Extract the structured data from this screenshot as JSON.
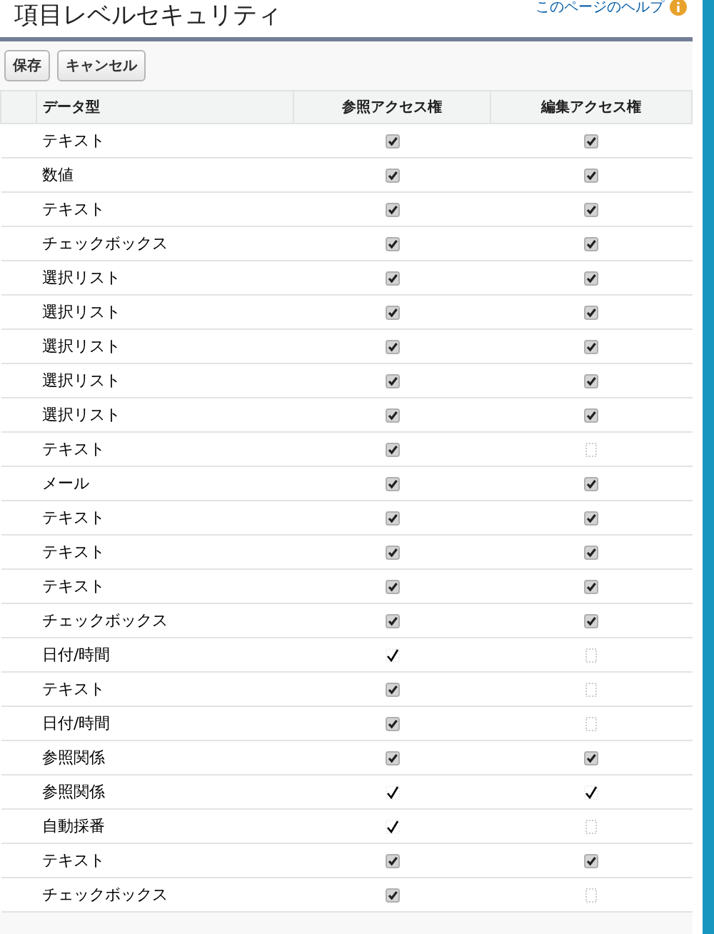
{
  "page": {
    "title": "項目レベルセキュリティ",
    "help_link": "このページのヘルプ"
  },
  "buttons": [
    "保存",
    "キャンセル"
  ],
  "table": {
    "columns": [
      "データ型",
      "参照アクセス権",
      "編集アクセス権"
    ],
    "rows": [
      {
        "type": "テキスト",
        "read": {
          "checked": true,
          "disabled": false
        },
        "edit": {
          "checked": true,
          "disabled": false
        }
      },
      {
        "type": "数値",
        "read": {
          "checked": true,
          "disabled": false
        },
        "edit": {
          "checked": true,
          "disabled": false
        }
      },
      {
        "type": "テキスト",
        "read": {
          "checked": true,
          "disabled": false
        },
        "edit": {
          "checked": true,
          "disabled": false
        }
      },
      {
        "type": "チェックボックス",
        "read": {
          "checked": true,
          "disabled": false
        },
        "edit": {
          "checked": true,
          "disabled": false
        }
      },
      {
        "type": "選択リスト",
        "read": {
          "checked": true,
          "disabled": false
        },
        "edit": {
          "checked": true,
          "disabled": false
        }
      },
      {
        "type": "選択リスト",
        "read": {
          "checked": true,
          "disabled": false
        },
        "edit": {
          "checked": true,
          "disabled": false
        }
      },
      {
        "type": "選択リスト",
        "read": {
          "checked": true,
          "disabled": false
        },
        "edit": {
          "checked": true,
          "disabled": false
        }
      },
      {
        "type": "選択リスト",
        "read": {
          "checked": true,
          "disabled": false
        },
        "edit": {
          "checked": true,
          "disabled": false
        }
      },
      {
        "type": "選択リスト",
        "read": {
          "checked": true,
          "disabled": false
        },
        "edit": {
          "checked": true,
          "disabled": false
        }
      },
      {
        "type": "テキスト",
        "read": {
          "checked": true,
          "disabled": false
        },
        "edit": {
          "checked": false,
          "disabled": true
        }
      },
      {
        "type": "メール",
        "read": {
          "checked": true,
          "disabled": false
        },
        "edit": {
          "checked": true,
          "disabled": false
        }
      },
      {
        "type": "テキスト",
        "read": {
          "checked": true,
          "disabled": false
        },
        "edit": {
          "checked": true,
          "disabled": false
        }
      },
      {
        "type": "テキスト",
        "read": {
          "checked": true,
          "disabled": false
        },
        "edit": {
          "checked": true,
          "disabled": false
        }
      },
      {
        "type": "テキスト",
        "read": {
          "checked": true,
          "disabled": false
        },
        "edit": {
          "checked": true,
          "disabled": false
        }
      },
      {
        "type": "チェックボックス",
        "read": {
          "checked": true,
          "disabled": false
        },
        "edit": {
          "checked": true,
          "disabled": false
        }
      },
      {
        "type": "日付/時間",
        "read": {
          "checked": true,
          "disabled": true
        },
        "edit": {
          "checked": false,
          "disabled": true
        }
      },
      {
        "type": "テキスト",
        "read": {
          "checked": true,
          "disabled": false
        },
        "edit": {
          "checked": false,
          "disabled": true
        }
      },
      {
        "type": "日付/時間",
        "read": {
          "checked": true,
          "disabled": false
        },
        "edit": {
          "checked": false,
          "disabled": true
        }
      },
      {
        "type": "参照関係",
        "read": {
          "checked": true,
          "disabled": false
        },
        "edit": {
          "checked": true,
          "disabled": false
        }
      },
      {
        "type": "参照関係",
        "read": {
          "checked": true,
          "disabled": true
        },
        "edit": {
          "checked": true,
          "disabled": true
        }
      },
      {
        "type": "自動採番",
        "read": {
          "checked": true,
          "disabled": true
        },
        "edit": {
          "checked": false,
          "disabled": true
        }
      },
      {
        "type": "テキスト",
        "read": {
          "checked": true,
          "disabled": false
        },
        "edit": {
          "checked": true,
          "disabled": false
        }
      },
      {
        "type": "チェックボックス",
        "read": {
          "checked": true,
          "disabled": false
        },
        "edit": {
          "checked": false,
          "disabled": true
        }
      }
    ]
  }
}
